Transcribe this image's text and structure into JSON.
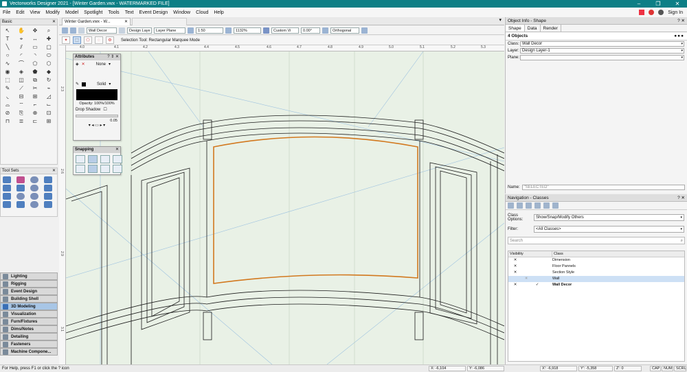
{
  "window": {
    "title": "Vectorworks Designer 2021 - [Winter Garden.vwx - WATERMARKED FILE]"
  },
  "menu": [
    "File",
    "Edit",
    "View",
    "Modify",
    "Model",
    "Spotlight",
    "Tools",
    "Text",
    "Event Design",
    "Window",
    "Cloud",
    "Help"
  ],
  "user": {
    "sign_in": "Sign In"
  },
  "palettes": {
    "basic": {
      "title": "Basic"
    },
    "tool_sets": {
      "title": "Tool Sets"
    }
  },
  "workspace": [
    {
      "label": "Lighting",
      "active": false
    },
    {
      "label": "Rigging",
      "active": false
    },
    {
      "label": "Event Design",
      "active": false
    },
    {
      "label": "Building Shell",
      "active": false
    },
    {
      "label": "3D Modeling",
      "active": true
    },
    {
      "label": "Visualization",
      "active": false
    },
    {
      "label": "Furn/Fixtures",
      "active": false
    },
    {
      "label": "Dims/Notes",
      "active": false
    },
    {
      "label": "Detailing",
      "active": false
    },
    {
      "label": "Fasteners",
      "active": false
    },
    {
      "label": "Machine Compone...",
      "active": false
    }
  ],
  "doc_tab": {
    "label": "Winter Garden.vwx - W..."
  },
  "view_bar": {
    "class": "Wall Decor",
    "layer": "Design Laye",
    "plane": "Layer Plane",
    "scale": "1:50",
    "zoom": "1132%",
    "view": "Custom Vi",
    "angle": "0.00°",
    "projection": "Orthogonal"
  },
  "mode_bar": {
    "help": "Selection Tool: Rectangular Marquee Mode"
  },
  "ruler_h": [
    "4.0",
    "4.1",
    "4.2",
    "4.3",
    "4.4",
    "4.5",
    "4.6",
    "4.7",
    "4.8",
    "4.9",
    "5.0",
    "5.1",
    "5.2",
    "5.3"
  ],
  "ruler_v": [
    "2.3",
    "2.6",
    "2.9",
    "3.1"
  ],
  "attributes": {
    "title": "Attributes",
    "fill_label": "None",
    "pen_label": "Solid",
    "opacity": "Opacity: 100%/100%",
    "drop_shadow": "Drop Shadow",
    "line_weight": "0.05"
  },
  "snapping": {
    "title": "Snapping"
  },
  "oip": {
    "title": "Object Info - Shape",
    "tabs": [
      "Shape",
      "Data",
      "Render"
    ],
    "objects": "4 Objects",
    "dots": "●●●",
    "class_label": "Class:",
    "class_value": "Wall Decor",
    "layer_label": "Layer:",
    "layer_value": "Design Layer-1",
    "plane_label": "Plane:",
    "plane_value": "",
    "name_label": "Name:",
    "name_value": "\"SELECTED\""
  },
  "nav": {
    "title": "Navigation - Classes",
    "class_options_label": "Class Options:",
    "class_options_value": "Show/Snap/Modify Others",
    "filter_label": "Filter:",
    "filter_value": "<All Classes>",
    "search_placeholder": "Search",
    "col_visibility": "Visibility",
    "col_class": "Class",
    "rows": [
      {
        "v1": "✕",
        "v2": "",
        "v3": "",
        "name": "Dimension",
        "bold": false,
        "selected": false
      },
      {
        "v1": "✕",
        "v2": "",
        "v3": "",
        "name": "Floor Pannels",
        "bold": false,
        "selected": false
      },
      {
        "v1": "✕",
        "v2": "",
        "v3": "",
        "name": "Section Style",
        "bold": false,
        "selected": false
      },
      {
        "v1": "",
        "v2": "✳",
        "v3": "",
        "name": "Wall",
        "bold": false,
        "selected": true
      },
      {
        "v1": "✕",
        "v2": "",
        "v3": "✓",
        "name": "Wall Decor",
        "bold": true,
        "selected": false
      }
    ]
  },
  "status": {
    "help": "For Help, press F1 or click the ? icon",
    "x": "X: -6,104",
    "y": "Y: -6,086",
    "x2": "X': -6,918",
    "y2": "Y': -5,358",
    "z": "Z': 0",
    "cap": "CAP",
    "num": "NUM",
    "scrl": "SCRL"
  }
}
